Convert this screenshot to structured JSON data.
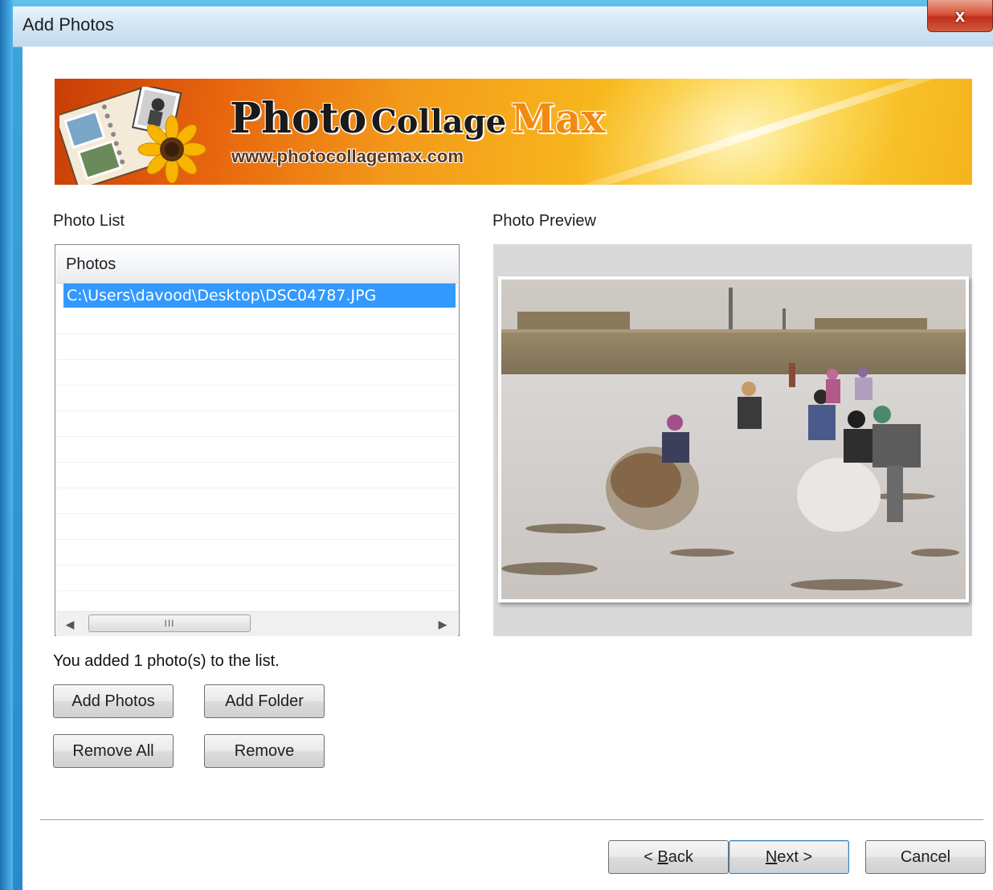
{
  "window": {
    "title": "Add Photos",
    "close_glyph": "x"
  },
  "banner": {
    "title_photo": "Photo",
    "title_collage": "Collage",
    "title_max": "Max",
    "url": "www.photocollagemax.com"
  },
  "photo_list": {
    "label": "Photo List",
    "column_header": "Photos",
    "items": [
      "C:\\Users\\davood\\Desktop\\DSC04787.JPG"
    ],
    "selected_index": 0
  },
  "preview": {
    "label": "Photo Preview"
  },
  "status_text": "You added 1 photo(s) to the list.",
  "buttons": {
    "add_photos": "Add Photos",
    "add_folder": "Add Folder",
    "remove_all": "Remove All",
    "remove": "Remove"
  },
  "nav": {
    "back_prefix": "< ",
    "back_accel": "B",
    "back_rest": "ack",
    "next_accel": "N",
    "next_rest": "ext >",
    "cancel": "Cancel"
  },
  "scrollbar": {
    "grip": "III"
  },
  "colors": {
    "selection": "#3399ff",
    "accent_orange": "#f28a12"
  }
}
